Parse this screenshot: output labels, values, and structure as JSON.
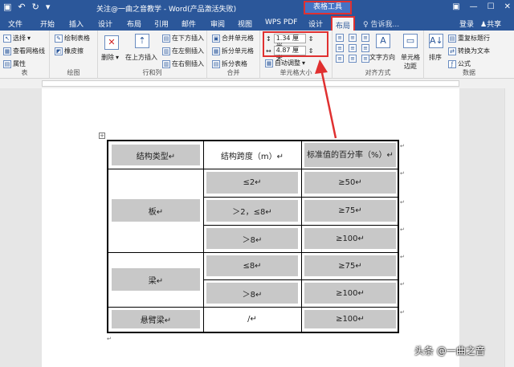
{
  "titlebar": {
    "doc_title": "关注@一曲之音教学 - Word(产品激活失败)",
    "context_tools": "表格工具",
    "save_icon": "save-icon",
    "undo_icon": "undo-icon",
    "redo_icon": "redo-icon"
  },
  "tabs": [
    "文件",
    "开始",
    "插入",
    "设计",
    "布局",
    "引用",
    "邮件",
    "审阅",
    "视图",
    "WPS PDF",
    "设计",
    "布局"
  ],
  "active_tab": "布局",
  "tell_me": "告诉我...",
  "login": "登录",
  "share": "共享",
  "ribbon": {
    "table_group": {
      "label": "表",
      "items": [
        "选择",
        "查看网格线",
        "属性"
      ]
    },
    "draw_group": {
      "label": "绘图",
      "items": [
        "绘制表格",
        "橡皮擦"
      ]
    },
    "rows_cols_group": {
      "label": "行和列",
      "delete": "删除",
      "insert_above": "在上方插入",
      "insert_below": "在下方插入",
      "insert_left": "在左侧插入",
      "insert_right": "在右侧插入"
    },
    "merge_group": {
      "label": "合并",
      "items": [
        "合并单元格",
        "拆分单元格",
        "拆分表格"
      ]
    },
    "cell_size_group": {
      "label": "单元格大小",
      "height": "1.34 厘米",
      "width": "4.87 厘米",
      "autofit": "自动调整"
    },
    "align_group": {
      "label": "对齐方式",
      "text_direction": "文字方向",
      "cell_margins": "单元格边距"
    },
    "data_group": {
      "label": "数据",
      "sort": "排序",
      "repeat_header": "重复标题行",
      "convert_text": "转换为文本",
      "formula": "公式"
    }
  },
  "table": {
    "headers": [
      "结构类型↵",
      "结构跨度（m）↵",
      "标准值的百分率（%）↵"
    ],
    "rows": [
      {
        "type": "板↵",
        "spans": [
          "≤2↵",
          "＞2，≤8↵",
          "＞8↵"
        ],
        "values": [
          "≥50↵",
          "≥75↵",
          "≥100↵"
        ]
      },
      {
        "type": "梁↵",
        "spans": [
          "≤8↵",
          "＞8↵"
        ],
        "values": [
          "≥75↵",
          "≥100↵"
        ]
      },
      {
        "type": "悬臂梁↵",
        "spans": [
          "/↵"
        ],
        "values": [
          "≥100↵"
        ]
      }
    ]
  },
  "watermark": "头条 @一曲之音"
}
